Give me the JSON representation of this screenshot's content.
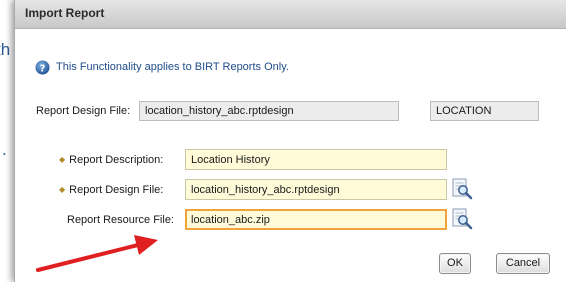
{
  "background": {
    "fragment_1": "th",
    "fragment_2": "."
  },
  "dialog": {
    "title": "Import Report",
    "info_icon": "help-icon",
    "info_text": "This Functionality applies to BIRT Reports Only.",
    "report_design_file_label": "Report Design File:",
    "report_design_file_value": "location_history_abc.rptdesign",
    "location_value": "LOCATION",
    "form": {
      "description_label": "Report Description:",
      "description_value": "Location History",
      "design_file_label": "Report Design File:",
      "design_file_value": "location_history_abc.rptdesign",
      "resource_file_label": "Report Resource File:",
      "resource_file_value": "location_abc.zip"
    },
    "ok_label": "OK",
    "cancel_label": "Cancel"
  },
  "colors": {
    "title_bar": "#d6d6d6",
    "input_bg": "#fffbd8",
    "focus_border": "#f0a33c",
    "annotation_arrow": "#e02020",
    "info_text": "#1f4d8a"
  }
}
